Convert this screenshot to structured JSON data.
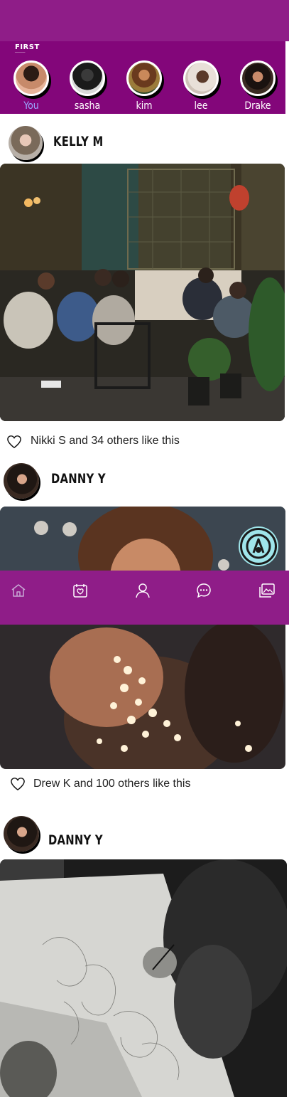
{
  "app": {
    "logo_text": "FIRST",
    "accent_color": "#8f1d88",
    "story_bar_color": "#83067a"
  },
  "stories": [
    {
      "label": "You",
      "icon": "cat-avatar"
    },
    {
      "label": "sasha",
      "icon": "person-avatar"
    },
    {
      "label": "kim",
      "icon": "person-avatar"
    },
    {
      "label": "lee",
      "icon": "person-avatar"
    },
    {
      "label": "Drake",
      "icon": "person-avatar"
    }
  ],
  "posts": [
    {
      "username": "KELLY M",
      "likes_text": "Nikki S and 34 others like this"
    },
    {
      "username": "DANNY Y",
      "likes_text": "Drew K  and 100 others like this"
    },
    {
      "username": "DANNY Y",
      "likes_text": ""
    }
  ],
  "nav": {
    "items": [
      "home-icon",
      "calendar-heart-icon",
      "profile-icon",
      "chat-icon",
      "gallery-icon"
    ]
  },
  "fab": {
    "icon": "compose-icon"
  }
}
